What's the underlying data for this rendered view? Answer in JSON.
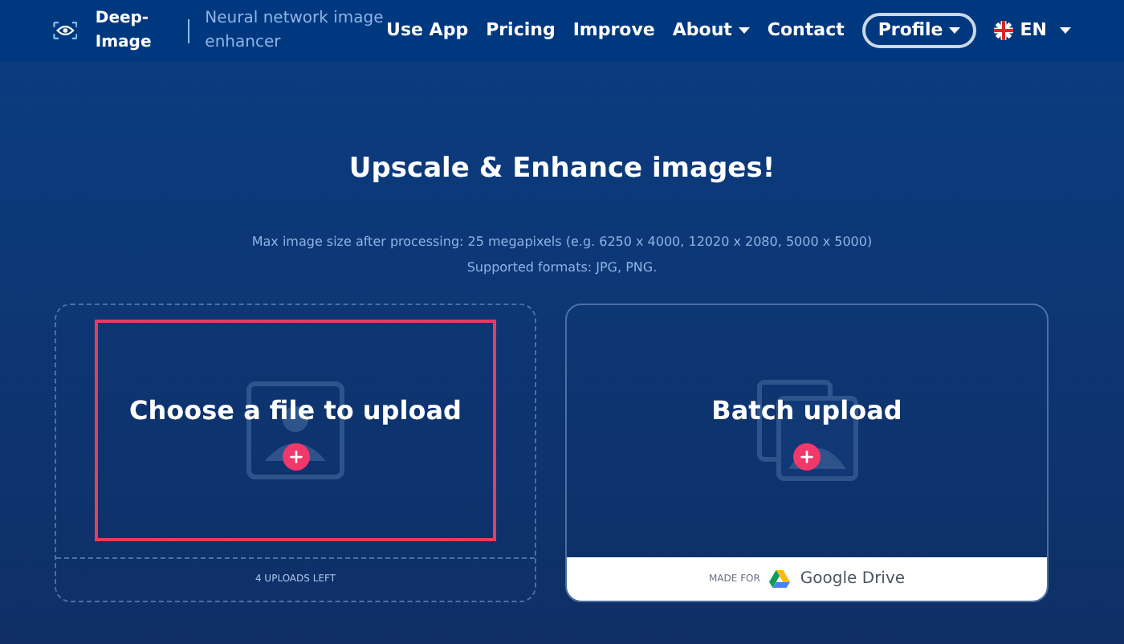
{
  "header": {
    "brand": "Deep-Image",
    "tagline": "Neural network image enhancer",
    "nav": [
      {
        "label": "Use App",
        "kind": "link"
      },
      {
        "label": "Pricing",
        "kind": "link"
      },
      {
        "label": "Improve",
        "kind": "link"
      },
      {
        "label": "About",
        "kind": "dropdown"
      },
      {
        "label": "Contact",
        "kind": "link"
      },
      {
        "label": "Profile",
        "kind": "pill"
      },
      {
        "label": "EN",
        "kind": "language"
      }
    ]
  },
  "hero": {
    "title": "Upscale & Enhance images!",
    "notes": [
      "Max image size after processing: 25 megapixels (e.g. 6250 x 4000, 12020 x 2080, 5000 x 5000)",
      "Supported formats: JPG, PNG."
    ]
  },
  "single_upload": {
    "title": "Choose a file to upload",
    "highlighted": true,
    "footer": "4 UPLOADS LEFT"
  },
  "batch_upload": {
    "title": "Batch upload",
    "footer_prefix": "MADE FOR",
    "footer_brand": "Google Drive"
  }
}
